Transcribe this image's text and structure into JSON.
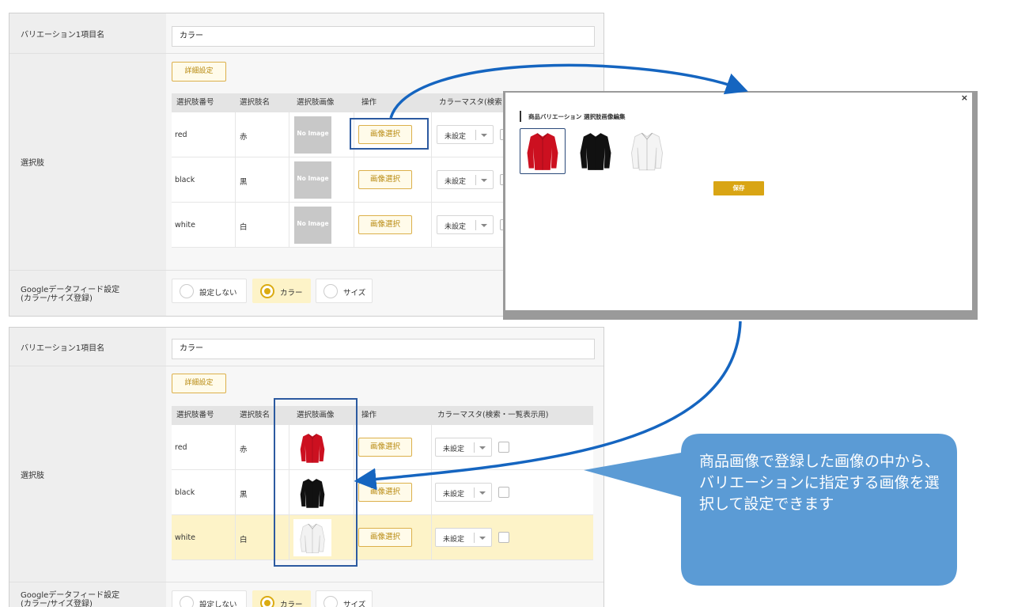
{
  "top_form": {
    "variation_label": "バリエーション1項目名",
    "variation_value": "カラー",
    "options_label": "選択肢",
    "detail_button": "詳細設定",
    "columns": [
      "選択肢番号",
      "選択肢名",
      "選択肢画像",
      "操作",
      "カラーマスタ(検索・"
    ],
    "rows": [
      {
        "number": "red",
        "name": "赤",
        "image": "No Image",
        "action": "画像選択",
        "master": "未設定"
      },
      {
        "number": "black",
        "name": "黒",
        "image": "No Image",
        "action": "画像選択",
        "master": "未設定"
      },
      {
        "number": "white",
        "name": "白",
        "image": "No Image",
        "action": "画像選択",
        "master": "未設定"
      }
    ],
    "feed_label_line1": "Googleデータフィード設定",
    "feed_label_line2": "(カラー/サイズ登録)",
    "feed_options": [
      "設定しない",
      "カラー",
      "サイズ"
    ],
    "feed_selected": "カラー"
  },
  "bottom_form": {
    "variation_label": "バリエーション1項目名",
    "variation_value": "カラー",
    "options_label": "選択肢",
    "detail_button": "詳細設定",
    "columns": [
      "選択肢番号",
      "選択肢名",
      "選択肢画像",
      "操作",
      "カラーマスタ(検索・一覧表示用)"
    ],
    "rows": [
      {
        "number": "red",
        "name": "赤",
        "image_icon": "red-shirt-icon",
        "action": "画像選択",
        "master": "未設定"
      },
      {
        "number": "black",
        "name": "黒",
        "image_icon": "black-shirt-icon",
        "action": "画像選択",
        "master": "未設定"
      },
      {
        "number": "white",
        "name": "白",
        "image_icon": "white-shirt-icon",
        "action": "画像選択",
        "master": "未設定"
      }
    ],
    "highlighted_row": "white",
    "feed_label_line1": "Googleデータフィード設定",
    "feed_label_line2": "(カラー/サイズ登録)",
    "feed_options": [
      "設定しない",
      "カラー",
      "サイズ"
    ],
    "feed_selected": "カラー"
  },
  "modal": {
    "title": "商品バリエーション 選択肢画像編集",
    "close": "×",
    "images": [
      "red-shirt-icon",
      "black-shirt-icon",
      "white-shirt-icon"
    ],
    "selected_image": "red-shirt-icon",
    "save_button": "保存"
  },
  "callout": {
    "text": "商品画像で登録した画像の中から、バリエーションに指定する画像を選択して設定できます"
  },
  "colors": {
    "accent_gold": "#dbab12",
    "arrow_blue": "#1565c0",
    "callout_blue": "#5b9bd5",
    "highlight_row": "#fdf3c8",
    "shirt_red": "#cc1020",
    "shirt_black": "#111111",
    "shirt_white": "#f2f2f2"
  }
}
